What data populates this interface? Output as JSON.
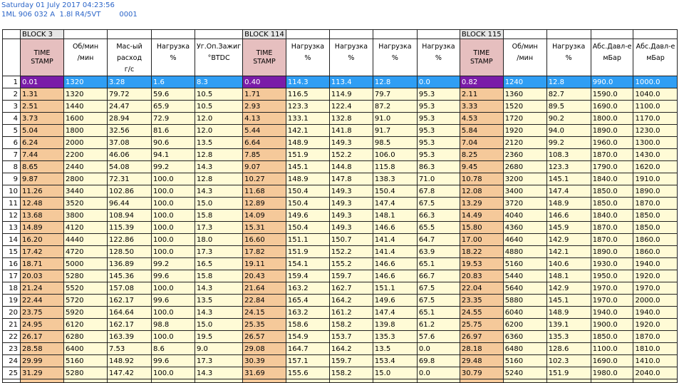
{
  "header": {
    "datetime": "Saturday 01 July 2017 04:23:56",
    "ecu": "1ML 906 032 A  1.8l R4/5VT",
    "code": "0001"
  },
  "blocks": [
    "BLOCK 3",
    "BLOCK 114",
    "BLOCK 115"
  ],
  "columns": [
    {
      "l1": "TIME",
      "l2": "STAMP",
      "unit": "",
      "ts": true
    },
    {
      "l1": "Об/мин",
      "l2": "",
      "unit": "/мин"
    },
    {
      "l1": "Мас-ый",
      "l2": "расход",
      "unit": "г/с"
    },
    {
      "l1": "Нагрузка",
      "l2": "",
      "unit": "%"
    },
    {
      "l1": "Уг.Оп.Зажиг",
      "l2": "",
      "unit": "°BTDC"
    },
    {
      "l1": "TIME",
      "l2": "STAMP",
      "unit": "",
      "ts": true
    },
    {
      "l1": "Нагрузка",
      "l2": "",
      "unit": "%"
    },
    {
      "l1": "Нагрузка",
      "l2": "",
      "unit": "%"
    },
    {
      "l1": "Нагрузка",
      "l2": "",
      "unit": "%"
    },
    {
      "l1": "Нагрузка",
      "l2": "",
      "unit": "%"
    },
    {
      "l1": "TIME",
      "l2": "STAMP",
      "unit": "",
      "ts": true
    },
    {
      "l1": "Об/мин",
      "l2": "",
      "unit": "/мин"
    },
    {
      "l1": "Нагрузка",
      "l2": "",
      "unit": "%"
    },
    {
      "l1": "Абс.Давл-е",
      "l2": "",
      "unit": "мБар"
    },
    {
      "l1": "Абс.Давл-е",
      "l2": "",
      "unit": "мБар"
    }
  ],
  "rows": [
    [
      "0.01",
      "1320",
      "3.28",
      "1.6",
      "8.3",
      "0.40",
      "114.3",
      "113.4",
      "12.8",
      "0.0",
      "0.82",
      "1240",
      "12.8",
      "990.0",
      "1000.0"
    ],
    [
      "1.31",
      "1320",
      "79.72",
      "59.6",
      "10.5",
      "1.71",
      "116.5",
      "114.9",
      "79.7",
      "95.3",
      "2.11",
      "1360",
      "82.7",
      "1590.0",
      "1040.0"
    ],
    [
      "2.51",
      "1440",
      "24.47",
      "65.9",
      "10.5",
      "2.93",
      "123.3",
      "122.4",
      "87.2",
      "95.3",
      "3.33",
      "1520",
      "89.5",
      "1690.0",
      "1100.0"
    ],
    [
      "3.73",
      "1600",
      "28.94",
      "72.9",
      "12.0",
      "4.13",
      "133.1",
      "132.8",
      "91.0",
      "95.3",
      "4.53",
      "1720",
      "90.2",
      "1800.0",
      "1170.0"
    ],
    [
      "5.04",
      "1800",
      "32.56",
      "81.6",
      "12.0",
      "5.44",
      "142.1",
      "141.8",
      "91.7",
      "95.3",
      "5.84",
      "1920",
      "94.0",
      "1890.0",
      "1230.0"
    ],
    [
      "6.24",
      "2000",
      "37.08",
      "90.6",
      "13.5",
      "6.64",
      "148.9",
      "149.3",
      "98.5",
      "95.3",
      "7.04",
      "2120",
      "99.2",
      "1960.0",
      "1300.0"
    ],
    [
      "7.44",
      "2200",
      "46.06",
      "94.1",
      "12.8",
      "7.85",
      "151.9",
      "152.2",
      "106.0",
      "95.3",
      "8.25",
      "2360",
      "108.3",
      "1870.0",
      "1430.0"
    ],
    [
      "8.65",
      "2440",
      "54.08",
      "99.2",
      "14.3",
      "9.07",
      "145.1",
      "144.8",
      "115.8",
      "86.3",
      "9.45",
      "2680",
      "123.3",
      "1790.0",
      "1620.0"
    ],
    [
      "9.87",
      "2800",
      "72.31",
      "100.0",
      "12.8",
      "10.27",
      "148.9",
      "147.8",
      "138.3",
      "71.0",
      "10.78",
      "3200",
      "145.1",
      "1840.0",
      "1910.0"
    ],
    [
      "11.26",
      "3440",
      "102.86",
      "100.0",
      "14.3",
      "11.68",
      "150.4",
      "149.3",
      "150.4",
      "67.8",
      "12.08",
      "3400",
      "147.4",
      "1850.0",
      "1890.0"
    ],
    [
      "12.48",
      "3520",
      "96.44",
      "100.0",
      "15.0",
      "12.89",
      "150.4",
      "149.3",
      "147.4",
      "67.5",
      "13.29",
      "3720",
      "148.9",
      "1850.0",
      "1870.0"
    ],
    [
      "13.68",
      "3800",
      "108.94",
      "100.0",
      "15.8",
      "14.09",
      "149.6",
      "149.3",
      "148.1",
      "66.3",
      "14.49",
      "4040",
      "146.6",
      "1840.0",
      "1850.0"
    ],
    [
      "14.89",
      "4120",
      "115.39",
      "100.0",
      "17.3",
      "15.31",
      "150.4",
      "149.3",
      "146.6",
      "65.5",
      "15.80",
      "4360",
      "145.9",
      "1870.0",
      "1850.0"
    ],
    [
      "16.20",
      "4440",
      "122.86",
      "100.0",
      "18.0",
      "16.60",
      "151.1",
      "150.7",
      "141.4",
      "64.7",
      "17.00",
      "4640",
      "142.9",
      "1870.0",
      "1860.0"
    ],
    [
      "17.42",
      "4720",
      "128.50",
      "100.0",
      "17.3",
      "17.82",
      "151.9",
      "152.2",
      "141.4",
      "63.9",
      "18.22",
      "4880",
      "142.1",
      "1890.0",
      "1860.0"
    ],
    [
      "18.71",
      "5000",
      "136.89",
      "99.2",
      "16.5",
      "19.11",
      "154.1",
      "155.2",
      "146.6",
      "65.1",
      "19.53",
      "5160",
      "140.6",
      "1930.0",
      "1940.0"
    ],
    [
      "20.03",
      "5280",
      "145.36",
      "99.6",
      "15.8",
      "20.43",
      "159.4",
      "159.7",
      "146.6",
      "66.7",
      "20.83",
      "5440",
      "148.1",
      "1950.0",
      "1920.0"
    ],
    [
      "21.24",
      "5520",
      "157.08",
      "100.0",
      "14.3",
      "21.64",
      "163.2",
      "162.7",
      "151.1",
      "67.5",
      "22.04",
      "5640",
      "142.9",
      "1970.0",
      "1970.0"
    ],
    [
      "22.44",
      "5720",
      "162.17",
      "99.6",
      "13.5",
      "22.84",
      "165.4",
      "164.2",
      "149.6",
      "67.5",
      "23.35",
      "5880",
      "145.1",
      "1970.0",
      "2000.0"
    ],
    [
      "23.75",
      "5920",
      "164.64",
      "100.0",
      "14.3",
      "24.15",
      "163.2",
      "161.2",
      "147.4",
      "65.1",
      "24.55",
      "6040",
      "148.9",
      "1940.0",
      "1940.0"
    ],
    [
      "24.95",
      "6120",
      "162.17",
      "98.8",
      "15.0",
      "25.35",
      "158.6",
      "158.2",
      "139.8",
      "61.2",
      "25.75",
      "6200",
      "139.1",
      "1900.0",
      "1920.0"
    ],
    [
      "26.17",
      "6280",
      "163.39",
      "100.0",
      "19.5",
      "26.57",
      "154.9",
      "153.7",
      "135.3",
      "57.6",
      "26.97",
      "6360",
      "135.3",
      "1850.0",
      "1870.0"
    ],
    [
      "28.58",
      "6400",
      "7.53",
      "8.6",
      "9.0",
      "29.08",
      "164.7",
      "164.2",
      "13.5",
      "0.0",
      "28.18",
      "6480",
      "128.6",
      "1100.0",
      "1810.0"
    ],
    [
      "29.99",
      "5160",
      "148.92",
      "99.6",
      "17.3",
      "30.39",
      "157.1",
      "159.7",
      "153.4",
      "69.8",
      "29.48",
      "5160",
      "102.3",
      "1690.0",
      "1410.0"
    ],
    [
      "31.29",
      "5280",
      "147.42",
      "100.0",
      "14.3",
      "31.69",
      "155.6",
      "158.2",
      "15.0",
      "0.0",
      "30.79",
      "5240",
      "151.9",
      "1980.0",
      "2040.0"
    ]
  ]
}
